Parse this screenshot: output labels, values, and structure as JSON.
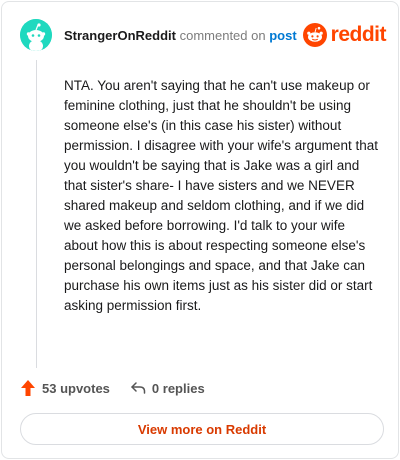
{
  "header": {
    "author": "StrangerOnReddit",
    "action_text": "commented on",
    "post_link": "post",
    "logo_text": "reddit",
    "avatar_icon": "snoo-avatar-icon",
    "logo_icon": "reddit-alien-icon"
  },
  "comment": {
    "body": "NTA. You aren't saying that he can't use makeup or feminine clothing, just that he shouldn't be using someone else's (in this case his sister) without permission. I disagree with your wife's argument that you wouldn't be saying that is Jake was a girl and that sister's share- I have sisters and we NEVER shared makeup and seldom clothing, and if we did we asked before borrowing. I'd talk to your wife about how this is about respecting someone else's personal belongings and space, and that Jake can purchase his own items just as his sister did or start asking permission first."
  },
  "footer": {
    "upvotes": "53 upvotes",
    "replies": "0 replies",
    "view_more": "View more on Reddit",
    "upvote_icon": "upvote-arrow-icon",
    "reply_icon": "reply-arrow-icon"
  },
  "colors": {
    "brand": "#ff4500",
    "link": "#0079d3",
    "avatar": "#1fd9bf",
    "button_text": "#d93a00"
  }
}
